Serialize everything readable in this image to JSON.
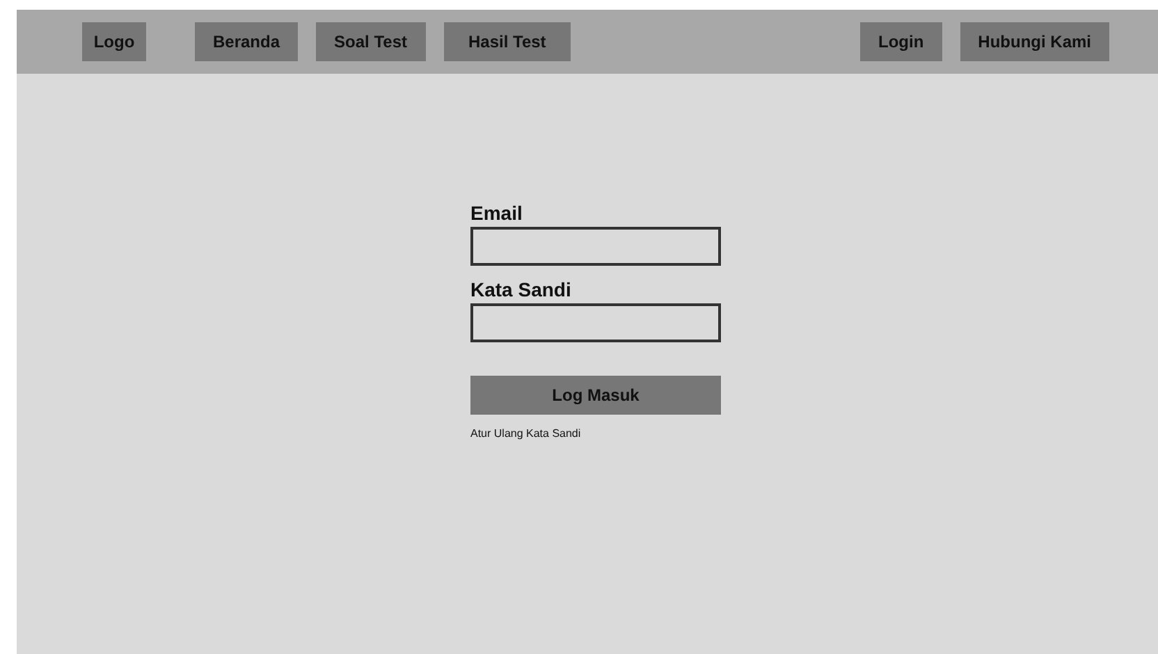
{
  "header": {
    "logo": "Logo",
    "nav_left": [
      "Beranda",
      "Soal Test",
      "Hasil Test"
    ],
    "nav_right": [
      "Login",
      "Hubungi Kami"
    ]
  },
  "form": {
    "fields": [
      {
        "label": "Email"
      },
      {
        "label": "Kata Sandi"
      }
    ],
    "submit": "Log Masuk",
    "reset_link": "Atur Ulang Kata Sandi"
  }
}
